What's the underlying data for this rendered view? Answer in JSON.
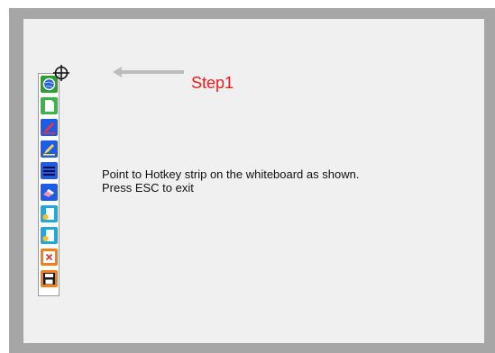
{
  "instructions": {
    "step_label": "Step1",
    "line1": "Point to Hotkey strip on the whiteboard as shown.",
    "line2": "Press ESC to exit"
  },
  "hotkey_strip": {
    "tools": [
      {
        "icon": "globe-icon",
        "color": "#2e9e2e"
      },
      {
        "icon": "new-page-icon",
        "color": "#39b54a"
      },
      {
        "icon": "red-pen-icon",
        "color": "#1e5be6"
      },
      {
        "icon": "highlighter-icon",
        "color": "#1e5be6"
      },
      {
        "icon": "line-width-icon",
        "color": "#1e5be6"
      },
      {
        "icon": "eraser-icon",
        "color": "#1e5be6"
      },
      {
        "icon": "pointer-icon",
        "color": "#22a7d8"
      },
      {
        "icon": "pointer-icon",
        "color": "#22a7d8"
      },
      {
        "icon": "close-icon",
        "color": "#f57f17"
      },
      {
        "icon": "save-icon",
        "color": "#f57f17"
      }
    ]
  },
  "colors": {
    "step_label": "#ee1c1c",
    "arrow": "#bdbdbd",
    "board": "#f0f0f0",
    "frame": "#a6a6a6"
  }
}
